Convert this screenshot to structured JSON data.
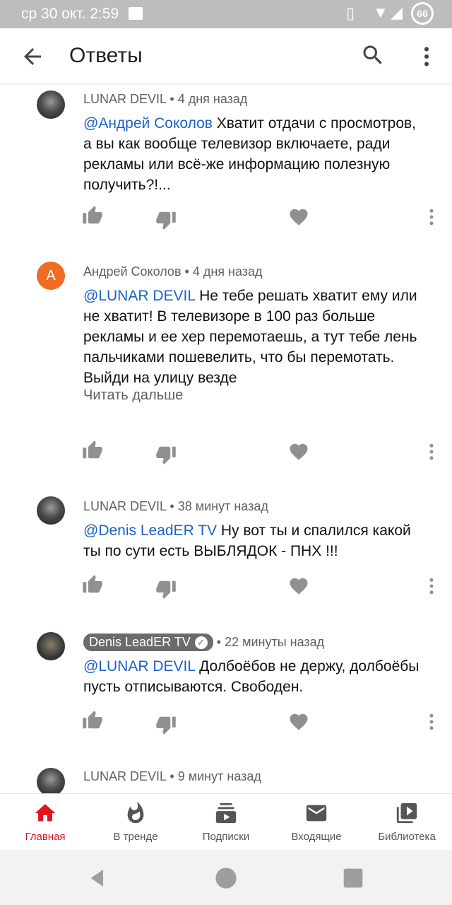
{
  "status_bar": {
    "time": "ср 30 окт. 2:59",
    "battery": "66",
    "icons": [
      "image-icon",
      "vibrate-icon",
      "wifi-icon",
      "signal-icon",
      "battery-icon"
    ]
  },
  "app_bar": {
    "title": "Ответы",
    "icons": [
      "back-arrow-icon",
      "search-icon",
      "more-vert-icon"
    ]
  },
  "comments": [
    {
      "author": "LUNAR DEVIL",
      "time": "4 дня назад",
      "mention": "@Андрей Соколов",
      "text": " Хватит отдачи с просмотров, а вы как вообще телевизор включаете, ради рекламы или всё-же информацию полезную получить?!...",
      "avatar": "dark"
    },
    {
      "author": "Андрей Соколов",
      "time": "4 дня назад",
      "mention": "@LUNAR DEVIL",
      "text": " Не тебе решать хватит ему или не хватит! В телевизоре в 100 раз больше рекламы  и ее хер перемотаешь, а тут тебе лень пальчиками пошевелить, что бы перемотать. Выйди на улицу везде",
      "read_more": "Читать дальше",
      "avatar_letter": "А"
    },
    {
      "author": "LUNAR DEVIL",
      "time": "38 минут назад",
      "mention": "@Denis LeadER TV",
      "text": " Ну вот ты и спалился какой ты по сути есть ВЫБЛЯДОК - ПНХ !!!",
      "avatar": "dark"
    },
    {
      "author": "Denis LeadER TV",
      "time": "22 минуты назад",
      "mention": "@LUNAR DEVIL",
      "text": " Долбоёбов не держу, долбоёбы пусть отписываются. Свободен.",
      "verified": true,
      "avatar": "photo"
    },
    {
      "author": "LUNAR DEVIL",
      "time": "9 минут назад",
      "avatar": "dark"
    }
  ],
  "separator": " • ",
  "bottom_nav": [
    {
      "label": "Главная",
      "icon": "home-icon",
      "active": true
    },
    {
      "label": "В тренде",
      "icon": "trending-flame-icon"
    },
    {
      "label": "Подписки",
      "icon": "subscriptions-icon"
    },
    {
      "label": "Входящие",
      "icon": "inbox-mail-icon"
    },
    {
      "label": "Библиотека",
      "icon": "library-icon"
    }
  ],
  "colors": {
    "accent_red": "#e0141e",
    "mention_blue": "#1a62c8",
    "avatar_orange": "#ef6c22",
    "action_grey": "#909090"
  }
}
